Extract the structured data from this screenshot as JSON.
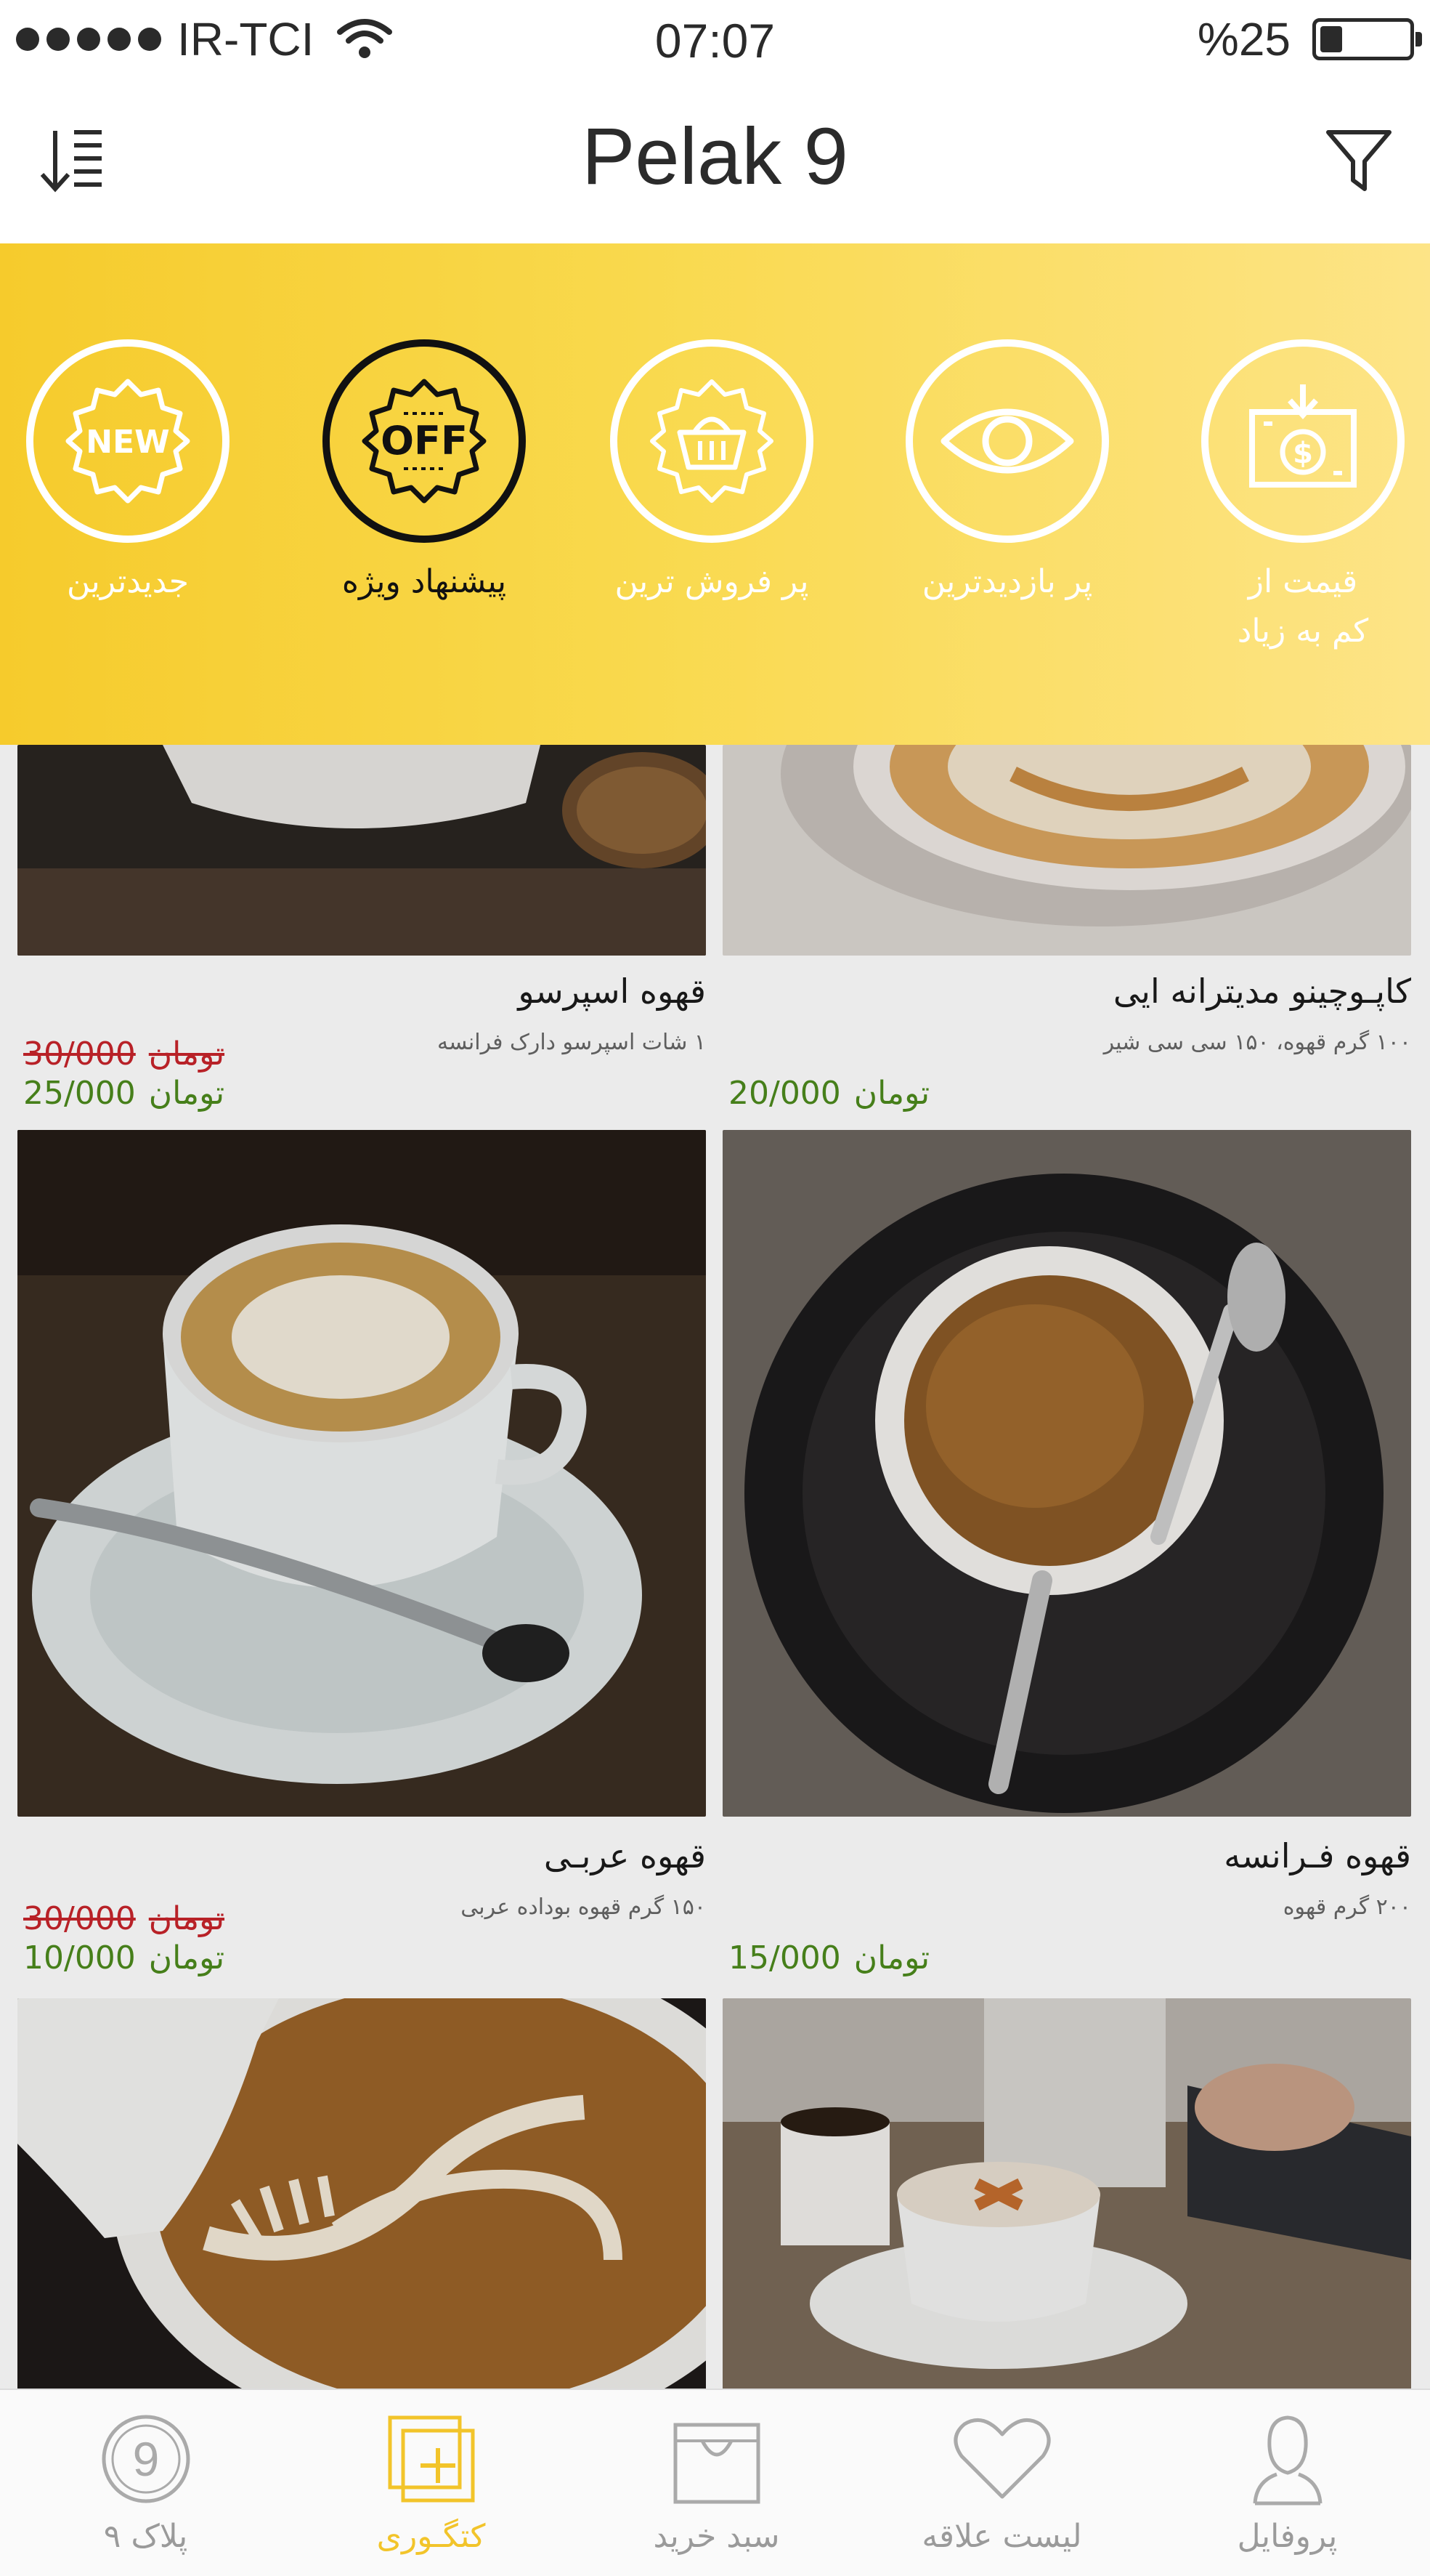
{
  "status_bar": {
    "carrier": "IR-TCI",
    "time": "07:07",
    "battery_text": "%25",
    "battery_level": 0.25
  },
  "nav": {
    "title": "Pelak 9"
  },
  "categories": [
    {
      "label": "قیمت از\nکم به زیاد",
      "icon": "money-down-icon",
      "active": false
    },
    {
      "label": "پر بازدیدترین",
      "icon": "eye-icon",
      "active": false
    },
    {
      "label": "پر فروش ترین",
      "icon": "basket-icon",
      "active": false
    },
    {
      "label": "پیشنهاد ویژه",
      "icon": "off-badge-icon",
      "badge": "OFF",
      "active": true
    },
    {
      "label": "جدیدترین",
      "icon": "new-badge-icon",
      "badge": "NEW",
      "active": false
    }
  ],
  "products": [
    {
      "title": "کاپـوچینو مدیترانه ایی",
      "desc": "۱۰۰ گرم قهوه، ۱۵۰ سی سی شیر",
      "price": "20/000",
      "old_price": "",
      "currency": "تومان"
    },
    {
      "title": "قهوه اسپرسو",
      "desc": "۱ شات اسپرسو دارک فرانسه",
      "price": "25/000",
      "old_price": "30/000",
      "currency": "تومان"
    },
    {
      "title": "قهوه فـرانسه",
      "desc": "۲۰۰ گرم قهوه",
      "price": "15/000",
      "old_price": "",
      "currency": "تومان"
    },
    {
      "title": "قهوه عربـی",
      "desc": "۱۵۰ گرم قهوه بوداده عربی",
      "price": "10/000",
      "old_price": "30/000",
      "currency": "تومان"
    }
  ],
  "colors": {
    "accent": "#f6cb2c",
    "price_new": "#4d8a1d",
    "price_old": "#c8242b"
  },
  "tabs": [
    {
      "label": "پروفایل",
      "icon": "user-icon",
      "active": false
    },
    {
      "label": "لیست علاقه",
      "icon": "heart-icon",
      "active": false
    },
    {
      "label": "سبد خرید",
      "icon": "shopping-bag-icon",
      "active": false
    },
    {
      "label": "کتگـوری",
      "icon": "category-icon",
      "active": true
    },
    {
      "label": "پلاک ۹",
      "icon": "pelak-9-icon",
      "badge": "9",
      "active": false
    }
  ]
}
